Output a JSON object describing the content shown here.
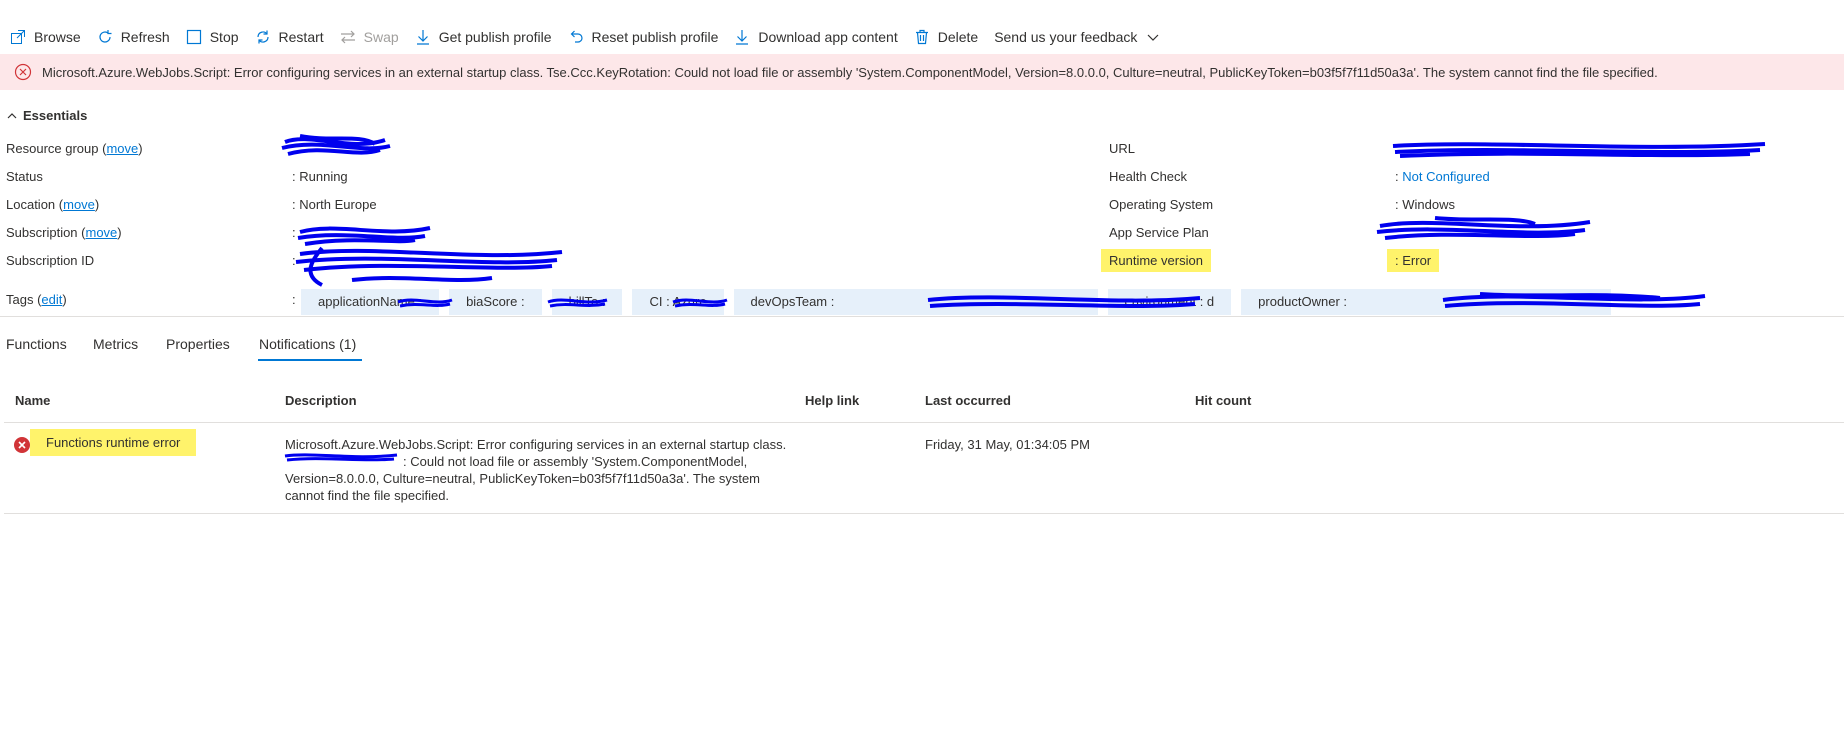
{
  "toolbar": {
    "browse": "Browse",
    "refresh": "Refresh",
    "stop": "Stop",
    "restart": "Restart",
    "swap": "Swap",
    "get_publish_profile": "Get publish profile",
    "reset_publish_profile": "Reset publish profile",
    "download_app_content": "Download app content",
    "delete": "Delete",
    "feedback": "Send us your feedback"
  },
  "banner": {
    "message": "Microsoft.Azure.WebJobs.Script: Error configuring services in an external startup class. Tse.Ccc.KeyRotation: Could not load file or assembly 'System.ComponentModel, Version=8.0.0.0, Culture=neutral, PublicKeyToken=b03f5f7f11d50a3a'. The system cannot find the file specified."
  },
  "essentials": {
    "title": "Essentials",
    "move": "move",
    "edit": "edit",
    "labels": {
      "resource_group": "Resource group",
      "status": "Status",
      "location": "Location",
      "subscription": "Subscription",
      "subscription_id": "Subscription ID",
      "tags": "Tags",
      "url": "URL",
      "health_check": "Health Check",
      "operating_system": "Operating System",
      "app_service_plan": "App Service Plan",
      "runtime_version": "Runtime version"
    },
    "values": {
      "status": "Running",
      "location": "North Europe",
      "health_check": "Not Configured",
      "operating_system": "Windows",
      "runtime_version": "Error"
    },
    "tags": [
      "applicationName : ",
      "biaScore : ",
      "billTo : ",
      "CI : Azure",
      "devOpsTeam : ",
      "environment : d",
      "productOwner : "
    ]
  },
  "tabs": [
    "Functions",
    "Metrics",
    "Properties",
    "Notifications (1)"
  ],
  "table": {
    "headers": [
      "Name",
      "Description",
      "Help link",
      "Last occurred",
      "Hit count"
    ],
    "rows": [
      {
        "name": "Functions runtime error",
        "description_line1": "Microsoft.Azure.WebJobs.Script: Error configuring services in an external startup class.",
        "description_line2": ": Could not load file or assembly 'System.ComponentModel,",
        "description_line3": "Version=8.0.0.0, Culture=neutral, PublicKeyToken=b03f5f7f11d50a3a'. The system",
        "description_line4": "cannot find the file specified.",
        "last_occurred": "Friday, 31 May, 01:34:05 PM"
      }
    ]
  },
  "colors": {
    "accent": "#0078d4",
    "error": "#d13438",
    "banner_bg": "#fde7e9",
    "highlight": "#fff36b",
    "tag_bg": "#e6f0fa",
    "redaction": "#0000ee"
  }
}
